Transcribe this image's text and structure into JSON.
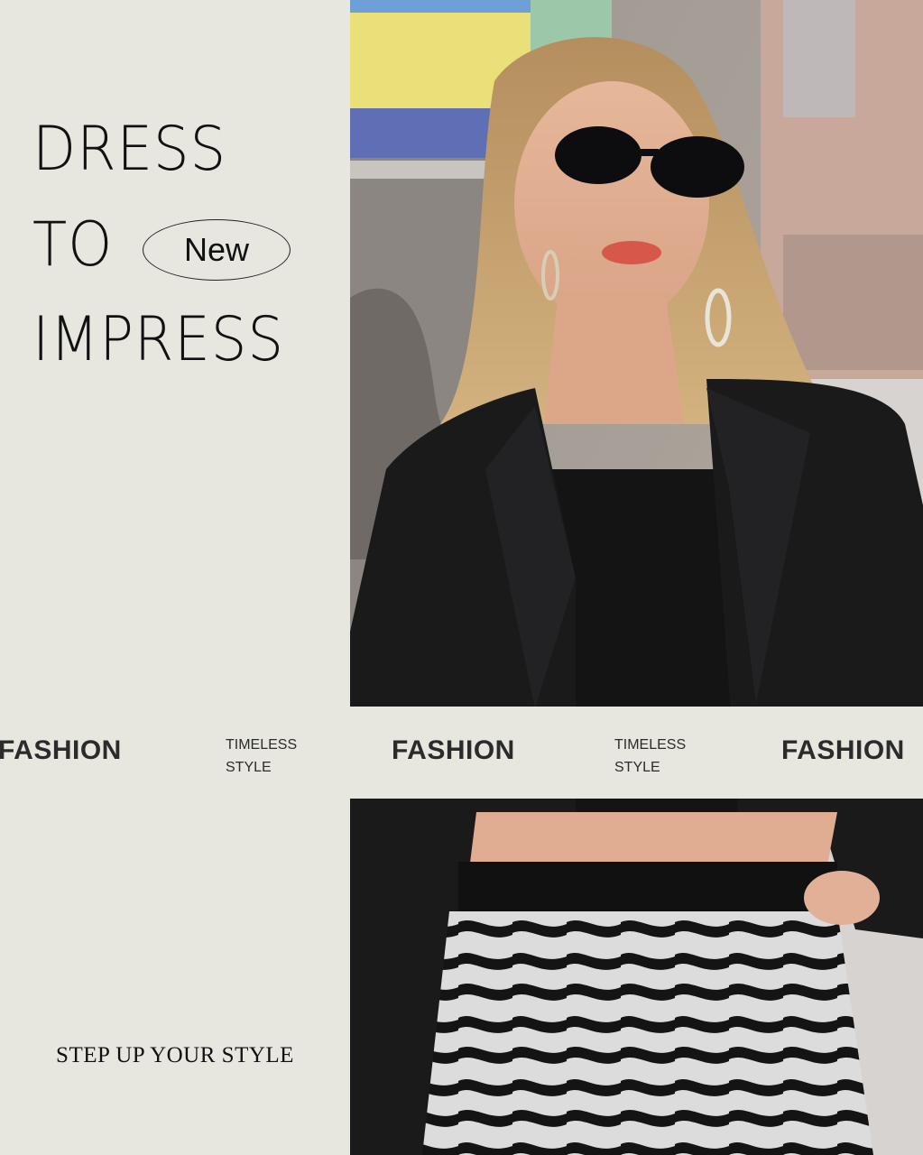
{
  "headline": {
    "line1": "DRESS",
    "line2": "TO",
    "line3": "IMPRESS",
    "badge": "New"
  },
  "tagline": "STEP UP YOUR STYLE",
  "band": {
    "big_1": "FASHION",
    "small_1_a": "TIMELESS",
    "small_1_b": "STYLE",
    "big_2": "FASHION",
    "small_2_a": "TIMELESS",
    "small_2_b": "STYLE",
    "big_3": "FASHION"
  },
  "colors": {
    "background": "#e7e7e0",
    "text": "#111111",
    "band_text": "#2b2b2b"
  }
}
